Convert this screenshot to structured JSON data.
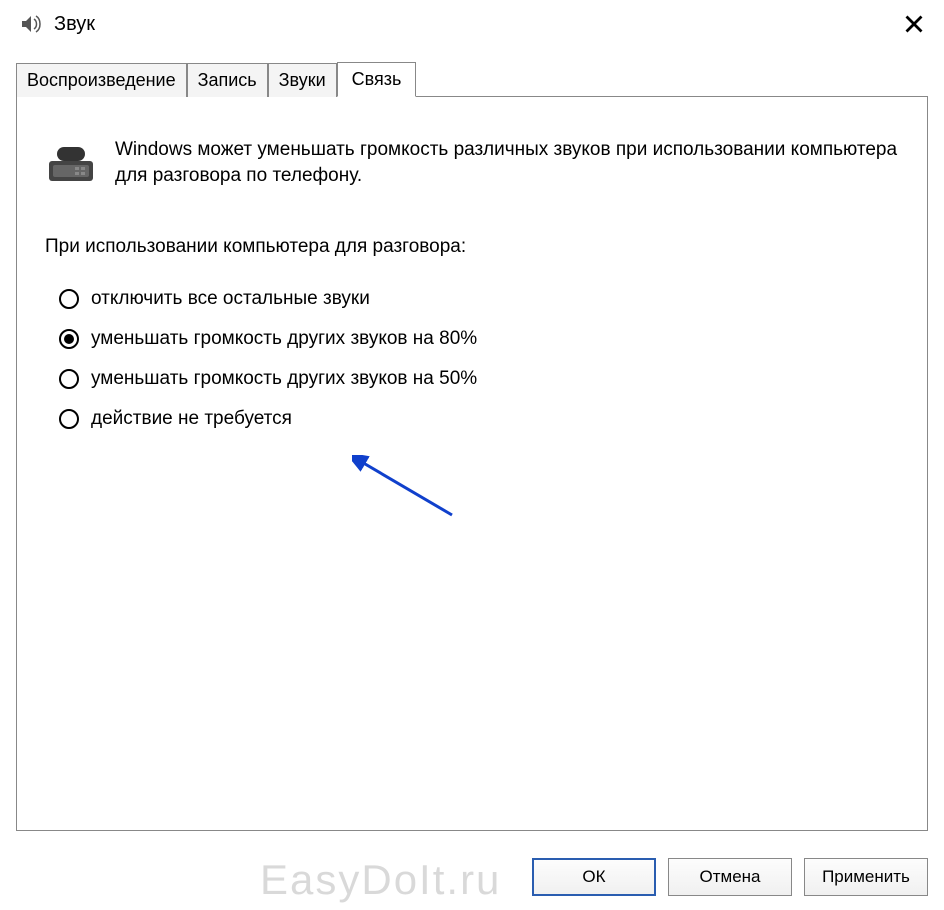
{
  "window": {
    "title": "Звук"
  },
  "tabs": {
    "playback": "Воспроизведение",
    "record": "Запись",
    "sounds": "Звуки",
    "comm": "Связь"
  },
  "panel": {
    "description": "Windows может уменьшать громкость различных звуков при использовании компьютера для разговора по телефону.",
    "subhead": "При использовании компьютера для разговора:",
    "options": {
      "mute": "отключить все остальные звуки",
      "reduce80": "уменьшать громкость других звуков на 80%",
      "reduce50": "уменьшать громкость других звуков на 50%",
      "none": "действие не требуется"
    },
    "selected": "reduce80"
  },
  "buttons": {
    "ok": "ОК",
    "cancel": "Отмена",
    "apply": "Применить"
  },
  "watermark": "EasyDoIt.ru"
}
